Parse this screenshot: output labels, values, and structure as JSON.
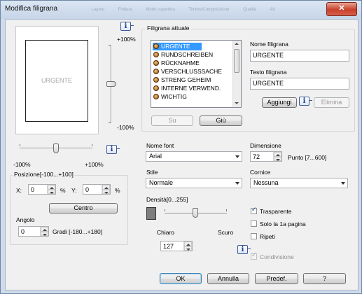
{
  "window": {
    "title": "Modifica filigrana",
    "close_glyph": "✕",
    "background_tabs": [
      "Layout",
      "Finitura",
      "Modo copertina",
      "Timbro/Composizione",
      "Qualità",
      "Alt"
    ]
  },
  "preview": {
    "watermark_text": "URGENTE",
    "vertical_max_label": "+100%",
    "vertical_min_label": "-100%",
    "horizontal_min_label": "-100%",
    "horizontal_max_label": "+100%",
    "vertical_slider_value": 0,
    "horizontal_slider_value": 0
  },
  "position": {
    "group_label": "Posizione[-100...+100]",
    "x_label": "X:",
    "x_value": "0",
    "x_unit": "%",
    "y_label": "Y:",
    "y_value": "0",
    "y_unit": "%",
    "center_button": "Centro"
  },
  "angle": {
    "label": "Angolo",
    "value": "0",
    "range_label": "Gradi [-180...+180]"
  },
  "current_watermark": {
    "group_label": "Filigrana attuale",
    "items": [
      "URGENTE",
      "RUNDSCHREIBEN",
      "RÜCKNAHME",
      "VERSCHLUSSSACHE",
      "STRENG GEHEIM",
      "INTERNE VERWEND.",
      "WICHTIG"
    ],
    "selected": "URGENTE",
    "up_button": "Su",
    "down_button": "Giù"
  },
  "name": {
    "label": "Nome filigrana",
    "value": "URGENTE"
  },
  "text": {
    "label": "Testo filigrana",
    "value": "URGENTE"
  },
  "actions": {
    "add_button": "Aggiungi",
    "delete_button": "Elimina"
  },
  "font": {
    "label": "Nome font",
    "value": "Arial"
  },
  "size": {
    "label": "Dimensione",
    "value": "72",
    "range_label": "Punto [7...600]"
  },
  "style": {
    "label": "Stile",
    "value": "Normale"
  },
  "frame": {
    "label": "Cornice",
    "value": "Nessuna"
  },
  "density": {
    "label": "Densità[0...255]",
    "light_label": "Chiaro",
    "dark_label": "Scuro",
    "value": "127",
    "slider_value": 127,
    "swatch_color": "#7d7d7d"
  },
  "options": {
    "transparent_label": "Trasparente",
    "transparent_checked": true,
    "first_page_label": "Solo la 1a pagina",
    "first_page_checked": false,
    "repeat_label": "Ripeti",
    "repeat_checked": false,
    "share_label": "Condivisione",
    "share_checked": true
  },
  "footer": {
    "ok_button": "OK",
    "cancel_button": "Annulla",
    "defaults_button": "Predef.",
    "help_button": "?"
  },
  "icons": {
    "info": "i"
  },
  "colors": {
    "selection": "#3399ff",
    "title_bar": "#c6d5e8",
    "close_button": "#c7402b"
  }
}
